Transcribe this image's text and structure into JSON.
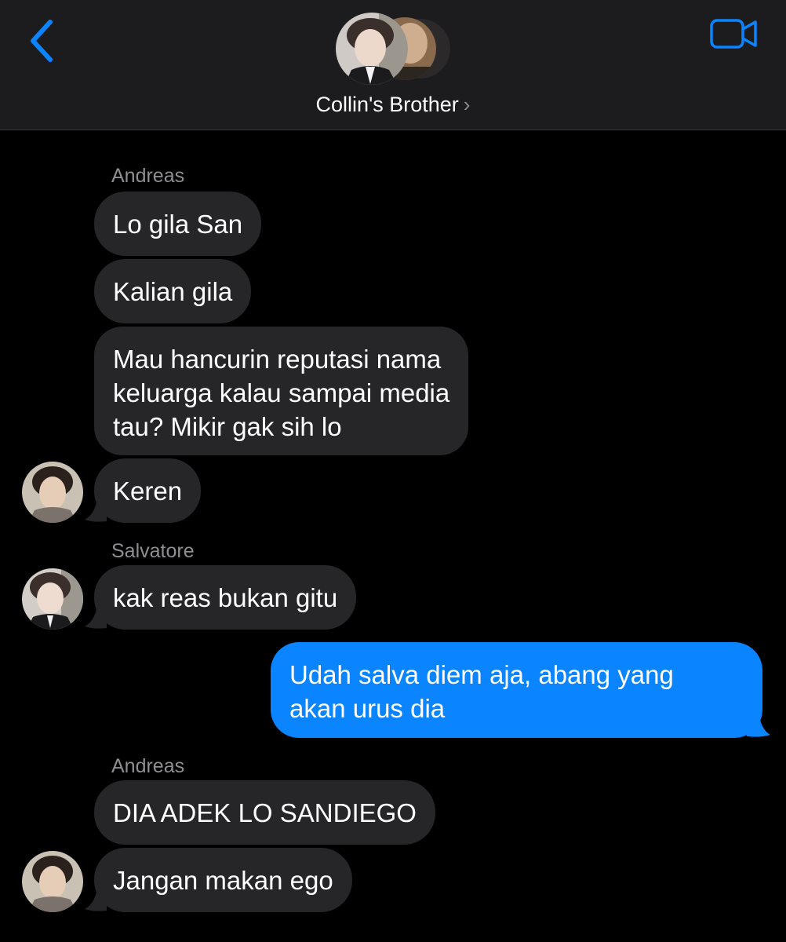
{
  "header": {
    "title": "Collin's Brother",
    "title_chevron": "›"
  },
  "messages": [
    {
      "sender": "Andreas"
    },
    {
      "text": "Lo gila San"
    },
    {
      "text": "Kalian gila"
    },
    {
      "lines": [
        "Mau hancurin reputasi nama",
        "keluarga kalau sampai media",
        "tau? Mikir gak sih lo"
      ]
    },
    {
      "text": "Keren"
    },
    {
      "sender": "Salvatore"
    },
    {
      "text": "kak reas bukan gitu"
    },
    {
      "lines": [
        "Udah salva diem aja, abang yang",
        "akan urus dia"
      ]
    },
    {
      "sender": "Andreas"
    },
    {
      "text": "DIA ADEK LO SANDIEGO"
    },
    {
      "text": "Jangan makan ego"
    }
  ],
  "colors": {
    "accent": "#0a84ff",
    "incoming_bubble": "#262628",
    "outgoing_bubble": "#0a84ff",
    "header_bg": "#1c1c1e",
    "secondary_text": "#8e8e93"
  },
  "icons": {
    "back": "chevron-left-icon",
    "video": "video-camera-icon"
  }
}
